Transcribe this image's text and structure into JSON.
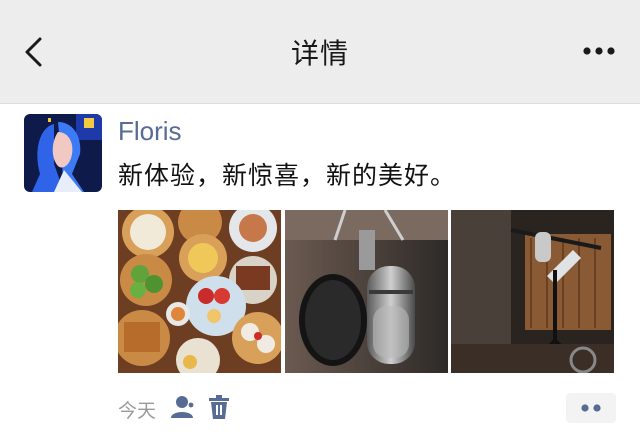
{
  "header": {
    "title": "详情",
    "back_icon": "chevron-left-icon",
    "more_icon": "more-dots-icon"
  },
  "post": {
    "author": "Floris",
    "text": "新体验，新惊喜，新的美好。",
    "photos": [
      {
        "subject": "dim sum dishes"
      },
      {
        "subject": "studio microphone with pop filter"
      },
      {
        "subject": "recording studio microphone stand"
      }
    ],
    "time": "今天",
    "actions": {
      "visibility_icon": "person-icon",
      "delete_icon": "trash-icon",
      "comment_icon": "more-dots-icon"
    }
  },
  "colors": {
    "header_bg": "#ededed",
    "link_name": "#576b95",
    "muted": "#9a9a9a"
  }
}
